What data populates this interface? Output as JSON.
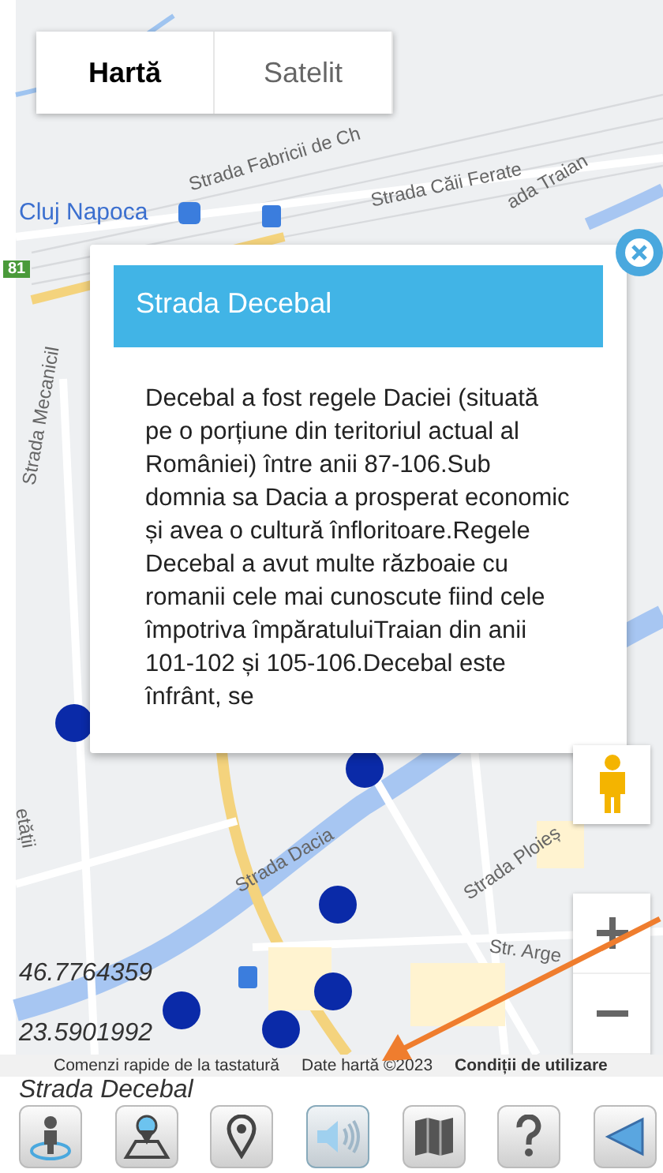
{
  "map_type_tabs": [
    {
      "label": "Hartă",
      "selected": true
    },
    {
      "label": "Satelit",
      "selected": false
    }
  ],
  "street_labels": [
    {
      "text": "Strada Fabricii de Ch"
    },
    {
      "text": "Strada Căii Ferate"
    },
    {
      "text": "ada Traian"
    },
    {
      "text": "Strada Mecanicil"
    },
    {
      "text": "etății"
    },
    {
      "text": "Strada Dacia"
    },
    {
      "text": "Strada Ploieș"
    },
    {
      "text": "Str. Arge"
    }
  ],
  "place_label": "Cluj Napoca",
  "road_shield": "81",
  "popup": {
    "title": "Strada Decebal",
    "body": "Decebal a fost regele Daciei (situată pe o porțiune din teritoriul actual al României) între anii 87-106.Sub domnia sa Dacia a prosperat economic și avea o cultură înfloritoare.Regele Decebal a avut multe războaie cu romanii cele mai cunoscute fiind cele împotriva împăratuluiTraian din anii 101-102 și 105-106.Decebal este înfrânt, se"
  },
  "coordinates": {
    "latitude": "46.7764359",
    "longitude": "23.5901992"
  },
  "attribution": {
    "shortcuts": "Comenzi rapide de la tastatură",
    "map_data": "Date hartă ©2023",
    "terms": "Condiții de utilizare"
  },
  "current_street": "Strada Decebal",
  "toolbar": [
    {
      "kind": "locate"
    },
    {
      "kind": "places"
    },
    {
      "kind": "pin"
    },
    {
      "kind": "audio",
      "selected": true
    },
    {
      "kind": "map"
    },
    {
      "kind": "help"
    },
    {
      "kind": "back"
    }
  ]
}
